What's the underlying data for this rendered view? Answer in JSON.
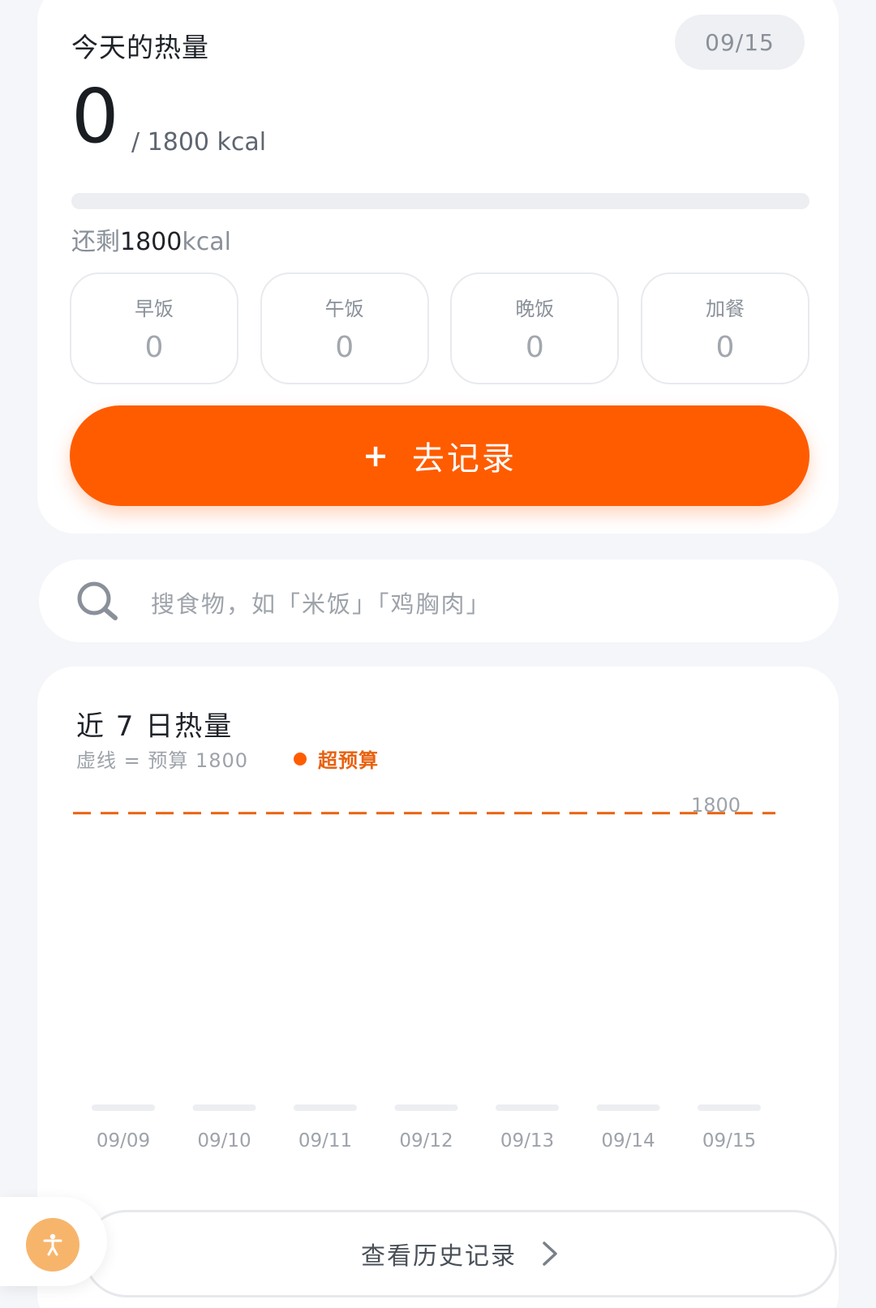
{
  "today": {
    "title": "今天的热量",
    "date": "09/15",
    "consumed": "0",
    "budget_text": "/ 1800 kcal",
    "progress_percent": 0,
    "remaining_prefix": "还剩",
    "remaining_value": "1800",
    "remaining_unit": "kcal",
    "meals": [
      {
        "label": "早饭",
        "value": "0"
      },
      {
        "label": "午饭",
        "value": "0"
      },
      {
        "label": "晚饭",
        "value": "0"
      },
      {
        "label": "加餐",
        "value": "0"
      }
    ],
    "record_button": {
      "plus": "+",
      "label": "去记录"
    }
  },
  "search": {
    "icon": "search-icon",
    "placeholder": "搜食物，如「米饭」「鸡胸肉」"
  },
  "week": {
    "title": "近 7 日热量",
    "subtitle": "虚线 = 预算 1800",
    "legend_label": "超预算",
    "history_button": "查看历史记录",
    "history_icon": "chevron-right-icon"
  },
  "chart_data": {
    "type": "bar",
    "categories": [
      "09/09",
      "09/10",
      "09/11",
      "09/12",
      "09/13",
      "09/14",
      "09/15"
    ],
    "values": [
      0,
      0,
      0,
      0,
      0,
      0,
      0
    ],
    "budget": 1800,
    "budget_label": "1800",
    "title": "近 7 日热量",
    "ylim": [
      0,
      2000
    ],
    "colors": {
      "budget_line": "#e8620f",
      "bar": "#eceef1",
      "over_budget": "#ff5c00"
    }
  },
  "colors": {
    "accent": "#ff5c00",
    "background": "#f4f6f9",
    "card": "#ffffff",
    "accessibility": "#f7b56c"
  },
  "floating": {
    "icon": "accessibility-icon"
  }
}
